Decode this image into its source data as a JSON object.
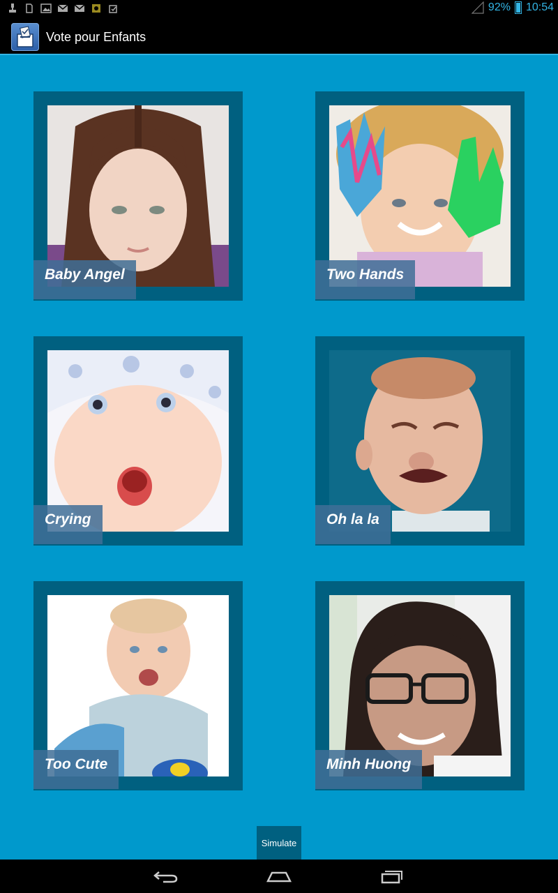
{
  "status_bar": {
    "battery": "92%",
    "time": "10:54",
    "icons": [
      "usb-debug-icon",
      "sd-card-icon",
      "image-icon",
      "mail-icon",
      "mail-icon",
      "app-notification-icon",
      "clipboard-icon"
    ]
  },
  "action_bar": {
    "title": "Vote pour Enfants",
    "icon": "ballot-box-icon"
  },
  "cards": [
    {
      "label": "Baby Angel"
    },
    {
      "label": "Two Hands"
    },
    {
      "label": "Crying"
    },
    {
      "label": "Oh la la"
    },
    {
      "label": "Too Cute"
    },
    {
      "label": "Minh Huong"
    }
  ],
  "simulate_label": "Simulate",
  "navigation": [
    "back-icon",
    "home-icon",
    "recent-apps-icon"
  ],
  "colors": {
    "background": "#0099CC",
    "card_frame": "#006080",
    "accent": "#33B5E5"
  }
}
